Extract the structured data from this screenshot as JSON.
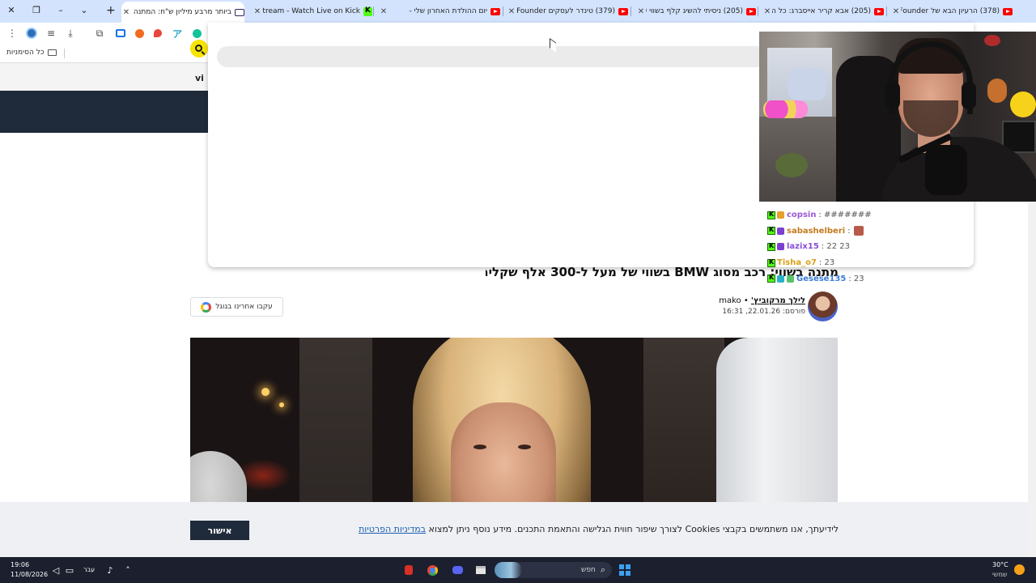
{
  "browser": {
    "tabs": [
      {
        "title": "ביותר מרבע מיליון ש\"ח: המתנה",
        "favicon": "n12-icon",
        "active": true
      },
      {
        "title": "IGZ_Stream - Watch Live on Kick",
        "favicon": "kick-icon",
        "active": false
      },
      {
        "title": "יום ההולדת האחרון שלי -",
        "favicon": "youtube-icon",
        "active": false
      },
      {
        "title": "(379) טינדר לעסקים deFounder",
        "favicon": "youtube-icon",
        "active": false
      },
      {
        "title": "(205) ניסיתי להשיג קלף בשווי 0",
        "favicon": "youtube-icon",
        "active": false
      },
      {
        "title": "(205) אבא קריר אייסברג: כל הה",
        "favicon": "youtube-icon",
        "active": false
      },
      {
        "title": "(378) הרעיון הבא של deFounder",
        "favicon": "youtube-icon",
        "active": false
      }
    ],
    "bookmarks_all_label": "כל הסימניות",
    "omnibox_value": ""
  },
  "site": {
    "subnav_label": "vi"
  },
  "article": {
    "title": "מתנה בשווי: רכב מסוג BMW בשווי של מעל ל-300 אלף שקלים",
    "author_name": "לילך מרקוביץ'",
    "author_suffix": "• mako",
    "published_prefix": "פורסם:",
    "published_datetime": "22.01.26, 16:31",
    "follow_google_label": "עקבו אחרינו בגוגל"
  },
  "cookie_banner": {
    "text": "לידיעתך, אנו משתמשים בקבצי Cookies לצורך שיפור חווית הגלישה והתאמת התכנים. מידע נוסף ניתן למצוא ",
    "link_text": "במדיניות הפרטיות",
    "confirm_label": "אישור"
  },
  "stream_chat": [
    {
      "user": "copsin",
      "user_color": "#9b59d6",
      "message": ": ####### "
    },
    {
      "user": "sabashelberi",
      "user_color": "#c47a1d",
      "message": ":",
      "emote": true
    },
    {
      "user": "lazix15",
      "user_color": "#8a4fd8",
      "message": ": 22 23"
    },
    {
      "user": "Tisha_o7",
      "user_color": "#d9a21b",
      "message": ": 23"
    },
    {
      "user": "Gesese135",
      "user_color": "#3b7dd8",
      "message": ": 23"
    }
  ],
  "taskbar": {
    "time": "19:06",
    "date": "11/08/2026",
    "language": "עבר",
    "search_label": "חפש",
    "weather_temp": "30°C",
    "weather_desc": "שמשי"
  },
  "colors": {
    "tabstrip_bg": "#d3e3fd",
    "site_nav_bg": "#1f2a3a",
    "search_accent": "#f7e400",
    "kick_green": "#53fc18",
    "cookie_link": "#1a5fb4"
  }
}
